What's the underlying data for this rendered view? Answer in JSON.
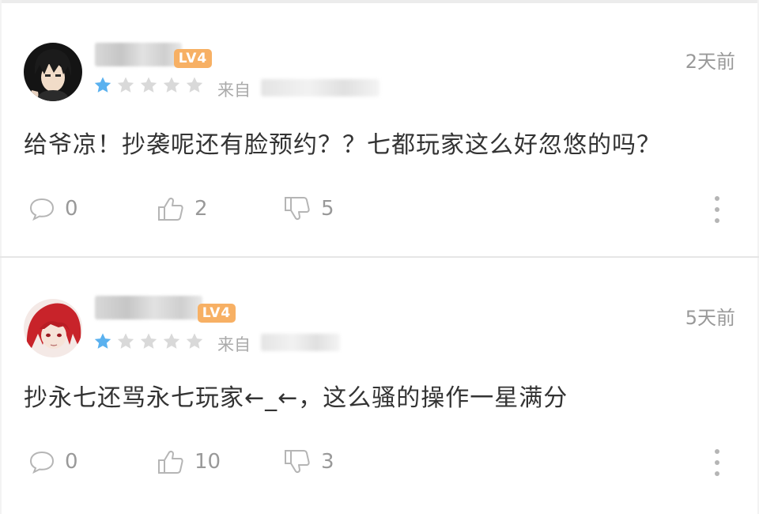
{
  "colors": {
    "star_active": "#5ab1ef",
    "star_inactive": "#d9d9d9",
    "level_badge": "#f7b064",
    "meta_text": "#999999"
  },
  "reviews": [
    {
      "level": "LV4",
      "time": "2天前",
      "rating": 1,
      "max_rating": 5,
      "source_prefix": "来自",
      "content": "给爷凉！抄袭呢还有脸预约？？七都玩家这么好忽悠的吗？",
      "reply_count": "0",
      "like_count": "2",
      "dislike_count": "5",
      "icons": [
        "reply-icon",
        "thumbs-up-icon",
        "thumbs-down-icon",
        "more-icon"
      ]
    },
    {
      "level": "LV4",
      "time": "5天前",
      "rating": 1,
      "max_rating": 5,
      "source_prefix": "来自",
      "content": "抄永七还骂永七玩家←_←，这么骚的操作一星满分",
      "reply_count": "0",
      "like_count": "10",
      "dislike_count": "3",
      "icons": [
        "reply-icon",
        "thumbs-up-icon",
        "thumbs-down-icon",
        "more-icon"
      ]
    }
  ]
}
